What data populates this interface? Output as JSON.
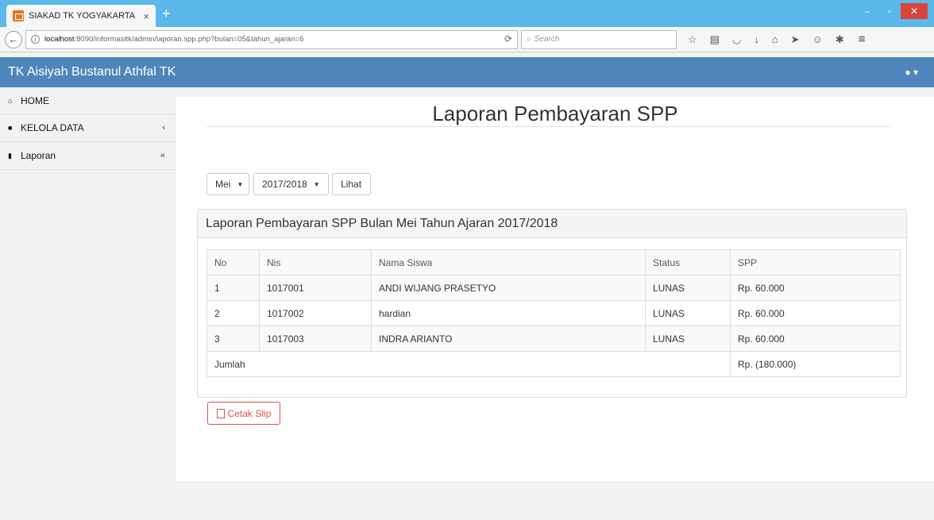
{
  "browser": {
    "tab_title": "SIAKAD TK YOGYAKARTA",
    "tab_close": "×",
    "new_tab": "+",
    "url_host": "localhost",
    "url_path": ":8090/informasitk/admin/laporan.spp.php?bulan=05&tahun_ajaran=6",
    "search_placeholder": "Search",
    "win_min": "–",
    "win_max": "▫",
    "win_close": "✕"
  },
  "header": {
    "brand": "TK Aisiyah Bustanul Athfal TK",
    "user_menu": "▾"
  },
  "sidebar": {
    "items": [
      {
        "label": "HOME",
        "icon": "home-icon",
        "arrow": ""
      },
      {
        "label": "KELOLA DATA",
        "icon": "folder-icon",
        "arrow": "‹"
      },
      {
        "label": "Laporan",
        "icon": "file-icon",
        "arrow": "«"
      }
    ]
  },
  "main": {
    "title": "Laporan Pembayaran SPP",
    "filters": {
      "month": "Mei",
      "year": "2017/2018",
      "submit": "Lihat"
    },
    "panel_title": "Laporan Pembayaran SPP Bulan Mei Tahun Ajaran 2017/2018",
    "table": {
      "headers": [
        "No",
        "Nis",
        "Nama Siswa",
        "Status",
        "SPP"
      ],
      "rows": [
        [
          "1",
          "1017001",
          "ANDI WIJANG PRASETYO",
          "LUNAS",
          "Rp. 60.000"
        ],
        [
          "2",
          "1017002",
          "hardian",
          "LUNAS",
          "Rp. 60.000"
        ],
        [
          "3",
          "1017003",
          "INDRA ARIANTO",
          "LUNAS",
          "Rp. 60.000"
        ]
      ],
      "footer_label": "Jumlah",
      "footer_total": "Rp. (180.000)"
    },
    "print_button": "Cetak Slip"
  },
  "colors": {
    "header_bg": "#4e86bb",
    "titlebar_bg": "#5ab8ea",
    "danger": "#d9534f"
  }
}
